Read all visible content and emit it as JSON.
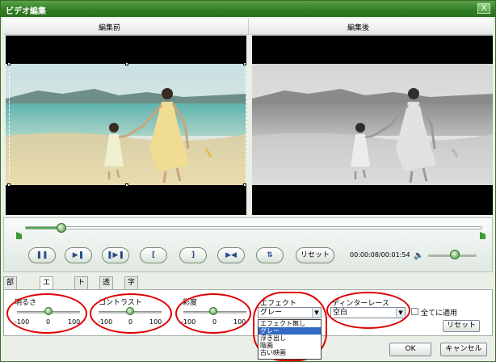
{
  "window": {
    "title": "ビデオ編集",
    "close_label": "X"
  },
  "preview": {
    "before_label": "編集前",
    "after_label": "編集後"
  },
  "playback": {
    "progress": 0.08,
    "pause_label": "❚❚",
    "play_label": "▶❚",
    "next_frame_label": "❚▶❚",
    "mark_in_label": "[",
    "mark_out_label": "]",
    "skip_label": "▶◀",
    "split_label": "⇅",
    "reset_label": "リセット",
    "time": "00:00:08/00:01:54",
    "volume": 0.55
  },
  "tabs": [
    {
      "label": "部分拡大"
    },
    {
      "label": "エフェクト"
    },
    {
      "label": "トリム"
    },
    {
      "label": "透かし"
    },
    {
      "label": "字幕"
    }
  ],
  "sliders": {
    "brightness": {
      "label": "明るさ",
      "min": "-100",
      "mid": "0",
      "max": "100",
      "value": 0
    },
    "contrast": {
      "label": "コントラスト",
      "min": "-100",
      "mid": "0",
      "max": "100",
      "value": 0
    },
    "saturation": {
      "label": "彩度",
      "min": "-100",
      "mid": "0",
      "max": "100",
      "value": 0
    }
  },
  "effect": {
    "label": "エフェクト",
    "selected": "グレー",
    "options": [
      "エフェクト無し",
      "グレー",
      "浮き出し",
      "陰画",
      "古い映画"
    ]
  },
  "deinterlace": {
    "label": "ディンターレース",
    "selected": "空白"
  },
  "apply_all_label": "全てに適用",
  "panel_reset_label": "リセット",
  "footer": {
    "ok_label": "OK",
    "cancel_label": "キャンセル"
  },
  "colors": {
    "annotation": "#e00000",
    "title_bar": "#2f7d22",
    "accent": "#3a8f2f"
  }
}
